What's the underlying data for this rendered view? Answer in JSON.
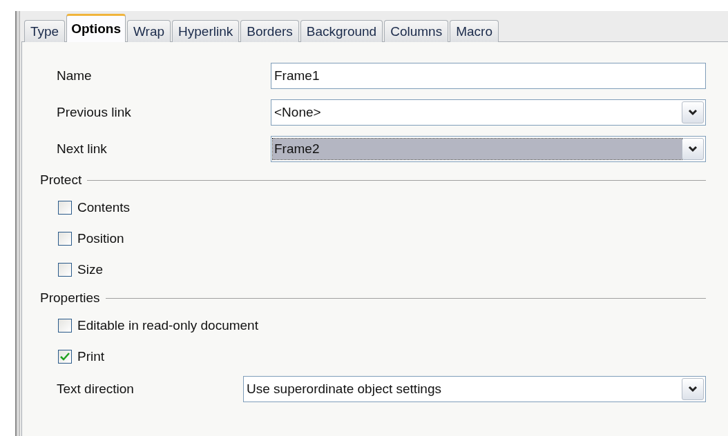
{
  "tabs": [
    {
      "label": "Type",
      "selected": false
    },
    {
      "label": "Options",
      "selected": true
    },
    {
      "label": "Wrap",
      "selected": false
    },
    {
      "label": "Hyperlink",
      "selected": false
    },
    {
      "label": "Borders",
      "selected": false
    },
    {
      "label": "Background",
      "selected": false
    },
    {
      "label": "Columns",
      "selected": false
    },
    {
      "label": "Macro",
      "selected": false
    }
  ],
  "fields": [
    {
      "label": "Name",
      "kind": "text",
      "value": "Frame1",
      "focused": false
    },
    {
      "label": "Previous link",
      "kind": "dropdown",
      "value": "<None>",
      "focused": false
    },
    {
      "label": "Next link",
      "kind": "dropdown",
      "value": "Frame2",
      "focused": true
    }
  ],
  "protect": {
    "title": "Protect",
    "options": [
      {
        "label": "Contents",
        "checked": false
      },
      {
        "label": "Position",
        "checked": false
      },
      {
        "label": "Size",
        "checked": false
      }
    ]
  },
  "properties": {
    "title": "Properties",
    "options": [
      {
        "label": "Editable in read-only document",
        "checked": false
      },
      {
        "label": "Print",
        "checked": true
      }
    ],
    "text_direction": {
      "label": "Text direction",
      "value": "Use superordinate object settings"
    }
  }
}
